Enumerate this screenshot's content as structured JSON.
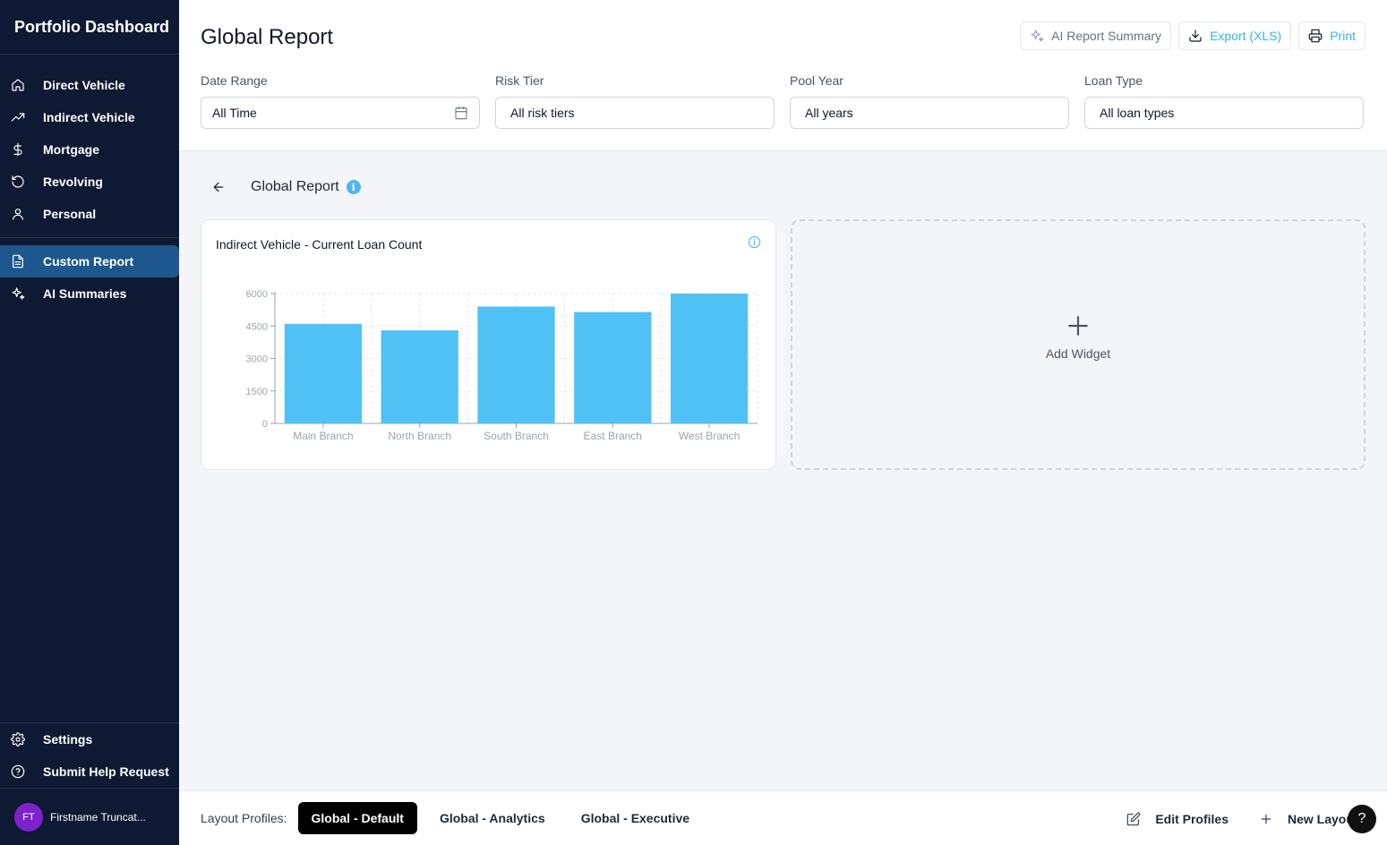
{
  "app": {
    "title": "Portfolio Dashboard"
  },
  "sidebar": {
    "items": [
      {
        "label": "Direct Vehicle",
        "icon": "home-icon"
      },
      {
        "label": "Indirect Vehicle",
        "icon": "trending-up-icon"
      },
      {
        "label": "Mortgage",
        "icon": "dollar-icon"
      },
      {
        "label": "Revolving",
        "icon": "refresh-icon"
      },
      {
        "label": "Personal",
        "icon": "user-icon"
      }
    ],
    "secondary": [
      {
        "label": "Custom Report",
        "icon": "document-icon",
        "active": true
      },
      {
        "label": "AI Summaries",
        "icon": "sparkles-icon"
      }
    ],
    "bottom": [
      {
        "label": "Settings",
        "icon": "gear-icon"
      },
      {
        "label": "Submit Help Request",
        "icon": "help-circle-icon"
      }
    ],
    "user": {
      "initials": "FT",
      "name": "Firstname Truncat..."
    }
  },
  "header": {
    "title": "Global Report",
    "actions": {
      "ai_summary": "AI Report Summary",
      "export": "Export (XLS)",
      "print": "Print"
    },
    "filters": [
      {
        "label": "Date Range",
        "value": "All Time"
      },
      {
        "label": "Risk Tier",
        "value": "All risk tiers"
      },
      {
        "label": "Pool Year",
        "value": "All years"
      },
      {
        "label": "Loan Type",
        "value": "All loan types"
      }
    ]
  },
  "content": {
    "breadcrumb_title": "Global Report",
    "info_glyph": "i",
    "add_widget_label": "Add Widget"
  },
  "chart_data": {
    "type": "bar",
    "title": "Indirect Vehicle - Current Loan Count",
    "categories": [
      "Main Branch",
      "North Branch",
      "South Branch",
      "East Branch",
      "West Branch"
    ],
    "values": [
      4600,
      4300,
      5400,
      5150,
      6000
    ],
    "yticks": [
      0,
      1500,
      3000,
      4500,
      6000
    ],
    "ylim": [
      0,
      6000
    ],
    "xlabel": "",
    "ylabel": "",
    "grid": true,
    "color": "#4fc1f5"
  },
  "footer": {
    "label": "Layout Profiles:",
    "profiles": [
      {
        "label": "Global - Default",
        "active": true
      },
      {
        "label": "Global - Analytics",
        "active": false
      },
      {
        "label": "Global - Executive",
        "active": false
      }
    ],
    "edit_label": "Edit Profiles",
    "new_label": "New Layout",
    "help_glyph": "?"
  },
  "colors": {
    "sidebar_bg": "#0e1a33",
    "active_nav": "#1d578d",
    "accent": "#38b2e8",
    "bar": "#4fc1f5",
    "avatar": "#7e22ce"
  }
}
